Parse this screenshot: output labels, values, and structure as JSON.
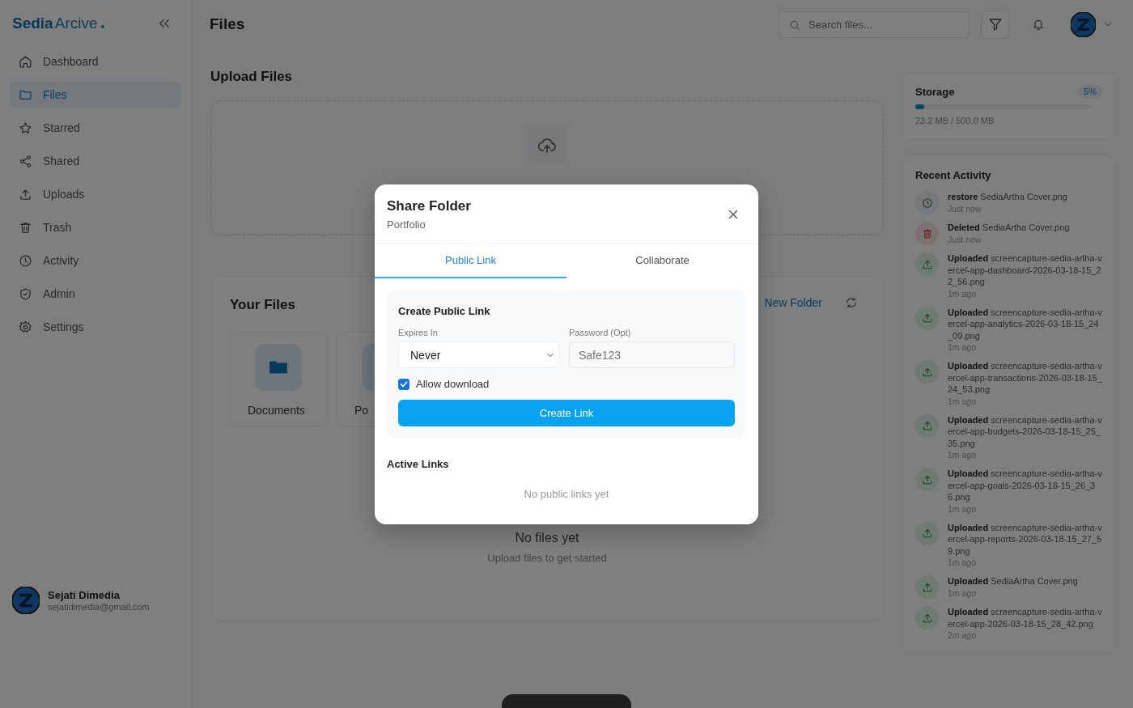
{
  "app": {
    "brand_bold": "Sedia",
    "brand_rest": "Arcive"
  },
  "sidebar": {
    "items": [
      {
        "label": "Dashboard",
        "kind": "home",
        "selected": false
      },
      {
        "label": "Files",
        "kind": "folder",
        "selected": true
      },
      {
        "label": "Starred",
        "kind": "star",
        "selected": false
      },
      {
        "label": "Shared",
        "kind": "share",
        "selected": false
      },
      {
        "label": "Uploads",
        "kind": "upload",
        "selected": false
      },
      {
        "label": "Trash",
        "kind": "trash",
        "selected": false
      },
      {
        "label": "Activity",
        "kind": "clock",
        "selected": false
      },
      {
        "label": "Admin",
        "kind": "shield",
        "selected": false
      },
      {
        "label": "Settings",
        "kind": "gear",
        "selected": false
      }
    ],
    "user": {
      "name": "Sejati Dimedia",
      "email": "sejatidimedia@gmail.com"
    }
  },
  "header": {
    "title": "Files",
    "search": {
      "placeholder": "Search files..."
    }
  },
  "upload": {
    "title": "Upload Files"
  },
  "files": {
    "title": "Your Files",
    "new_folder": "New Folder",
    "folders": [
      {
        "name": "Documents"
      },
      {
        "name": "Po"
      }
    ],
    "empty_title": "No files yet",
    "empty_hint": "Upload files to get started"
  },
  "storage": {
    "title": "Storage",
    "percent": "5%",
    "level": 0.05,
    "usage": "23.2 MB / 500.0 MB"
  },
  "activity": {
    "title": "Recent Activity",
    "items": [
      {
        "kind": "restore",
        "action": "restore",
        "file": "SediaArtha Cover.png",
        "time": "Just now"
      },
      {
        "kind": "deleted",
        "action": "Deleted",
        "file": "SediaArtha Cover.png",
        "time": "Just now"
      },
      {
        "kind": "uploaded",
        "action": "Uploaded",
        "file": "screencapture-sedia-artha-vercel-app-dashboard-2026-03-18-15_22_56.png",
        "time": "1m ago"
      },
      {
        "kind": "uploaded",
        "action": "Uploaded",
        "file": "screencapture-sedia-artha-vercel-app-analytics-2026-03-18-15_24_09.png",
        "time": "1m ago"
      },
      {
        "kind": "uploaded",
        "action": "Uploaded",
        "file": "screencapture-sedia-artha-vercel-app-transactions-2026-03-18-15_24_53.png",
        "time": "1m ago"
      },
      {
        "kind": "uploaded",
        "action": "Uploaded",
        "file": "screencapture-sedia-artha-vercel-app-budgets-2026-03-18-15_25_35.png",
        "time": "1m ago"
      },
      {
        "kind": "uploaded",
        "action": "Uploaded",
        "file": "screencapture-sedia-artha-vercel-app-goals-2026-03-18-15_26_36.png",
        "time": "1m ago"
      },
      {
        "kind": "uploaded",
        "action": "Uploaded",
        "file": "screencapture-sedia-artha-vercel-app-reports-2026-03-18-15_27_59.png",
        "time": "1m ago"
      },
      {
        "kind": "uploaded",
        "action": "Uploaded",
        "file": "SediaArtha Cover.png",
        "time": "1m ago"
      },
      {
        "kind": "uploaded",
        "action": "Uploaded",
        "file": "screencapture-sedia-artha-vercel-app-2026-03-18-15_28_42.png",
        "time": "2m ago"
      }
    ]
  },
  "dialog": {
    "title": "Share Folder",
    "subtitle": "Portfolio",
    "tabs": [
      {
        "label": "Public Link",
        "selected": true
      },
      {
        "label": "Collaborate",
        "selected": false
      }
    ],
    "section_title": "Create Public Link",
    "expires": {
      "label": "Expires In",
      "value": "Never"
    },
    "password": {
      "label": "Password (Opt)",
      "placeholder": "Safe123"
    },
    "allow_download": {
      "label": "Allow download",
      "checked": true
    },
    "create_button": "Create Link",
    "active_links_title": "Active Links",
    "active_links_empty": "No public links yet"
  }
}
